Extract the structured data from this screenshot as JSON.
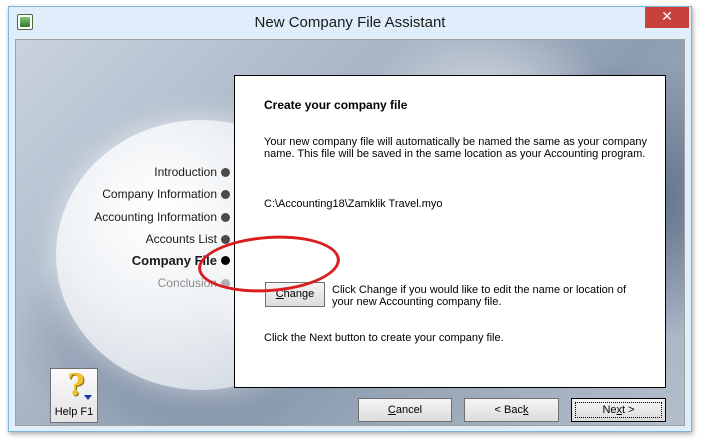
{
  "window": {
    "title": "New Company File Assistant",
    "close_glyph": "✕"
  },
  "steps": [
    {
      "label": "Introduction",
      "state": "done"
    },
    {
      "label": "Company Information",
      "state": "done"
    },
    {
      "label": "Accounting Information",
      "state": "done"
    },
    {
      "label": "Accounts List",
      "state": "done"
    },
    {
      "label": "Company File",
      "state": "current"
    },
    {
      "label": "Conclusion",
      "state": "future"
    }
  ],
  "panel": {
    "heading": "Create your company file",
    "description": "Your new company file will automatically be named the same as your company name.  This file will be saved in the same location as your Accounting program.",
    "file_path": "C:\\Accounting18\\Zamklik Travel.myo",
    "change_button": {
      "prefix": "",
      "accel": "C",
      "rest": "hange"
    },
    "change_description": "Click Change if you would like to edit the name or location of your new Accounting company file.",
    "next_description": "Click the Next button to create your company file."
  },
  "buttons": {
    "cancel": {
      "accel": "C",
      "rest": "ancel"
    },
    "back": {
      "prefix": "< Bac",
      "accel": "k",
      "rest": ""
    },
    "next": {
      "prefix": "Ne",
      "accel": "x",
      "rest": "t >"
    }
  },
  "help": {
    "label": "Help F1",
    "icon_glyph": "?"
  },
  "colors": {
    "title_bar": "#dfeefa",
    "close_button": "#c8413a",
    "highlight_annotation": "#d81e1e"
  }
}
